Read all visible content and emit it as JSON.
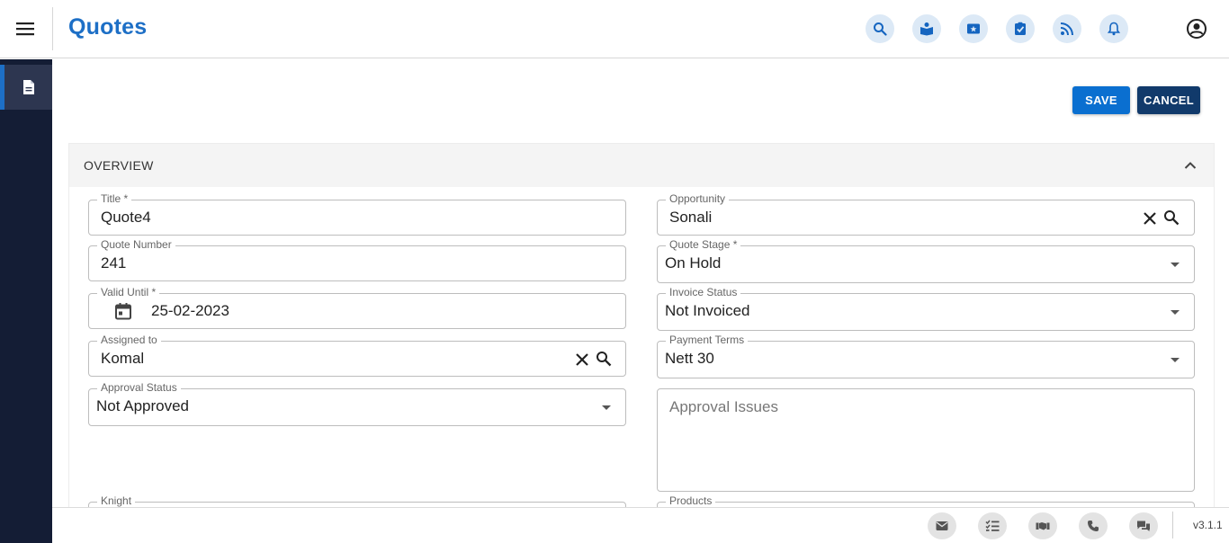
{
  "header": {
    "title": "Quotes",
    "icons": [
      "search-icon",
      "knowledge-icon",
      "tickets-icon",
      "tasks-icon",
      "feed-icon",
      "notifications-icon"
    ],
    "accent_color": "#1d6fc6"
  },
  "sidebar": {
    "items": [
      {
        "icon": "document-icon",
        "active": true
      }
    ],
    "background": "#141d35"
  },
  "actions": {
    "save_label": "SAVE",
    "cancel_label": "CANCEL"
  },
  "panel": {
    "title": "OVERVIEW",
    "fields": {
      "title": {
        "label": "Title *",
        "value": "Quote4"
      },
      "quote_number": {
        "label": "Quote Number",
        "value": "241"
      },
      "valid_until": {
        "label": "Valid Until *",
        "value": "25-02-2023"
      },
      "assigned_to": {
        "label": "Assigned to",
        "value": "Komal"
      },
      "approval_status": {
        "label": "Approval Status",
        "value": "Not Approved"
      },
      "knight": {
        "label": "Knight"
      },
      "opportunity": {
        "label": "Opportunity",
        "value": "Sonali"
      },
      "quote_stage": {
        "label": "Quote Stage *",
        "value": "On Hold"
      },
      "invoice_status": {
        "label": "Invoice Status",
        "value": "Not Invoiced"
      },
      "payment_terms": {
        "label": "Payment Terms",
        "value": "Nett 30"
      },
      "approval_issues": {
        "placeholder": "Approval Issues"
      },
      "products": {
        "label": "Products"
      }
    }
  },
  "footer": {
    "icons": [
      "email-icon",
      "checklist-icon",
      "meeting-icon",
      "phone-icon",
      "chat-icon"
    ],
    "version": "v3.1.1"
  }
}
